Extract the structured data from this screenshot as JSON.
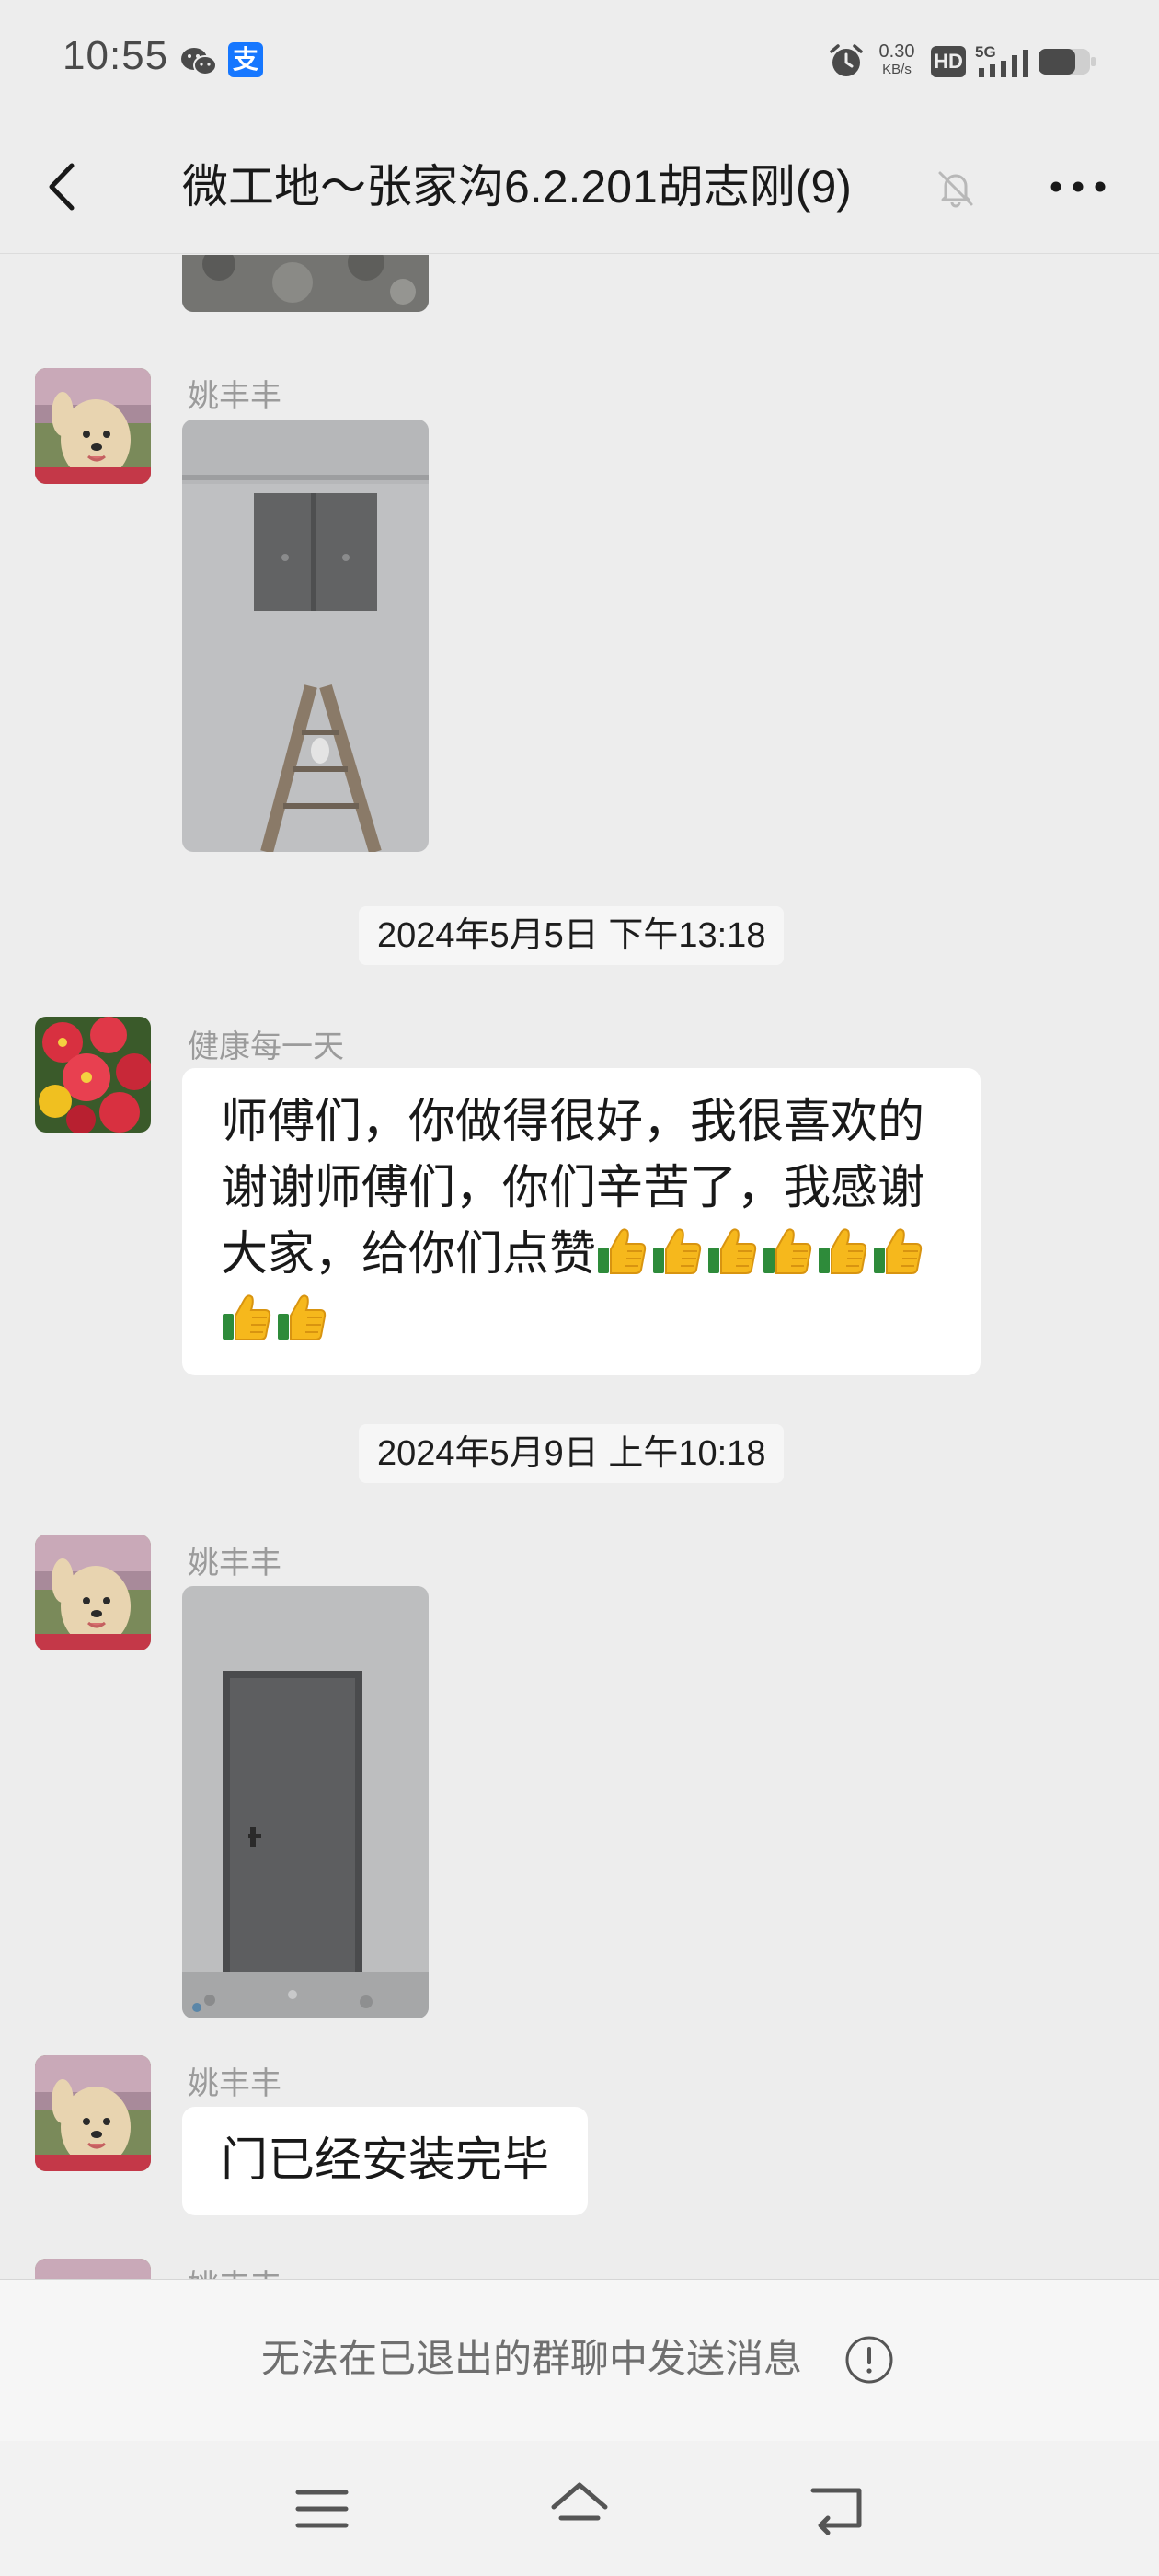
{
  "status_bar": {
    "time": "10:55",
    "net_speed_value": "0.30",
    "net_speed_unit": "KB/s",
    "hd_label": "HD",
    "network_label": "5G",
    "icons": [
      "wechat-icon",
      "alipay-icon",
      "alarm-icon",
      "hd-icon",
      "signal-icon",
      "battery-icon"
    ],
    "alipay_glyph": "支"
  },
  "nav": {
    "title": "微工地～张家沟6.2.201胡志刚(9)",
    "icons": [
      "back-icon",
      "mute-icon",
      "more-icon"
    ]
  },
  "messages": [
    {
      "type": "image",
      "sender": "",
      "partial": true
    },
    {
      "type": "image",
      "sender": "姚丰丰"
    },
    {
      "type": "timestamp",
      "text": "2024年5月5日  下午13:18"
    },
    {
      "type": "text",
      "sender": "健康每一天",
      "text": "师傅们，你做得很好，我很喜欢的谢谢师傅们，你们辛苦了，我感谢大家，给你们点赞",
      "emoji": "thumbs-up",
      "emoji_count": 8
    },
    {
      "type": "timestamp",
      "text": "2024年5月9日  上午10:18"
    },
    {
      "type": "image",
      "sender": "姚丰丰"
    },
    {
      "type": "text",
      "sender": "姚丰丰",
      "text": "门已经安装完毕"
    },
    {
      "type": "partial",
      "sender": "姚丰丰"
    }
  ],
  "footer": {
    "disabled_message": "无法在已退出的群聊中发送消息",
    "icon": "info-icon"
  },
  "system_nav": {
    "icons": [
      "menu-icon",
      "home-icon",
      "back-nav-icon"
    ]
  },
  "colors": {
    "background": "#ededed",
    "bubble": "#ffffff",
    "sender_name": "#9b9b9b",
    "alipay_blue": "#1677ff"
  }
}
